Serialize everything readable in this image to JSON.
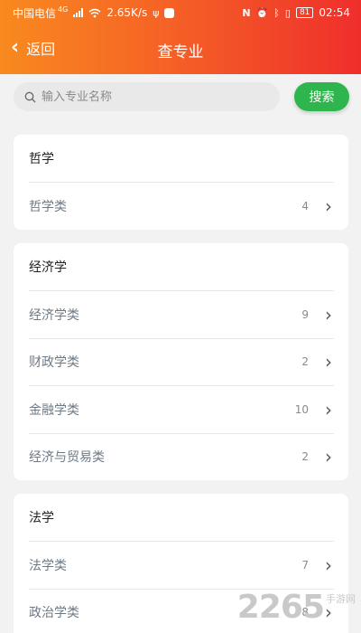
{
  "status_bar": {
    "carrier": "中国电信",
    "network": "4G",
    "speed": "2.65K/s",
    "battery": "81",
    "time": "02:54"
  },
  "nav": {
    "back_label": "返回",
    "title": "查专业"
  },
  "search": {
    "placeholder": "输入专业名称",
    "button_label": "搜索"
  },
  "sections": [
    {
      "title": "哲学",
      "items": [
        {
          "label": "哲学类",
          "count": "4"
        }
      ]
    },
    {
      "title": "经济学",
      "items": [
        {
          "label": "经济学类",
          "count": "9"
        },
        {
          "label": "财政学类",
          "count": "2"
        },
        {
          "label": "金融学类",
          "count": "10"
        },
        {
          "label": "经济与贸易类",
          "count": "2"
        }
      ]
    },
    {
      "title": "法学",
      "items": [
        {
          "label": "法学类",
          "count": "7"
        },
        {
          "label": "政治学类",
          "count": "8"
        }
      ]
    }
  ],
  "watermark": {
    "number": "2265",
    "text": "手游网"
  },
  "colors": {
    "header_gradient_start": "#f98a1f",
    "header_gradient_end": "#ef2e2c",
    "search_button": "#2fb54d"
  }
}
